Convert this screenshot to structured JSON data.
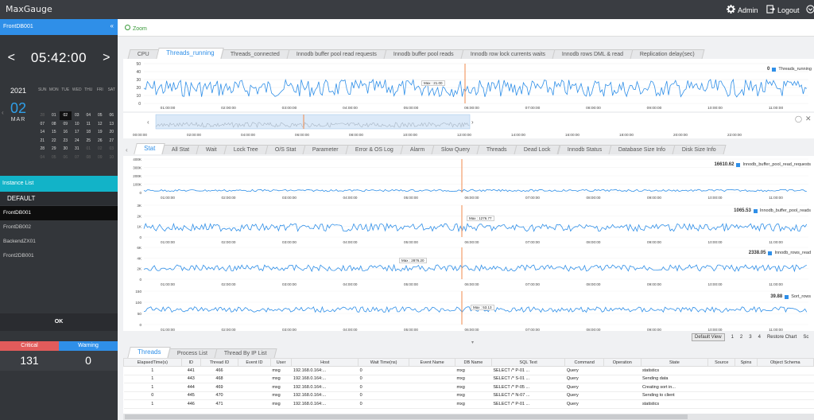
{
  "app": {
    "logo": "MaxGauge",
    "admin_label": "Admin",
    "logout_label": "Logout"
  },
  "sidebar": {
    "server_name": "FrontDB001",
    "collapse_glyph": "«",
    "time": "05:42:00",
    "prev_glyph": "<",
    "next_glyph": ">",
    "calendar": {
      "year": "2021",
      "day": "02",
      "month": "MAR",
      "day_headers": [
        "SUN",
        "MON",
        "TUE",
        "WED",
        "THU",
        "FRI",
        "SAT"
      ],
      "days": [
        {
          "d": "28",
          "dim": true
        },
        {
          "d": "01"
        },
        {
          "d": "02",
          "sel": true
        },
        {
          "d": "03"
        },
        {
          "d": "04"
        },
        {
          "d": "05"
        },
        {
          "d": "06"
        },
        {
          "d": "07"
        },
        {
          "d": "08"
        },
        {
          "d": "09"
        },
        {
          "d": "10"
        },
        {
          "d": "11"
        },
        {
          "d": "12"
        },
        {
          "d": "13"
        },
        {
          "d": "14"
        },
        {
          "d": "15"
        },
        {
          "d": "16"
        },
        {
          "d": "17"
        },
        {
          "d": "18"
        },
        {
          "d": "19"
        },
        {
          "d": "20"
        },
        {
          "d": "21"
        },
        {
          "d": "22"
        },
        {
          "d": "23"
        },
        {
          "d": "24"
        },
        {
          "d": "25"
        },
        {
          "d": "26"
        },
        {
          "d": "27"
        },
        {
          "d": "28"
        },
        {
          "d": "29"
        },
        {
          "d": "30"
        },
        {
          "d": "31"
        },
        {
          "d": "01",
          "dim": true
        },
        {
          "d": "02",
          "dim": true
        },
        {
          "d": "03",
          "dim": true
        },
        {
          "d": "04",
          "dim": true
        },
        {
          "d": "05",
          "dim": true
        },
        {
          "d": "06",
          "dim": true
        },
        {
          "d": "07",
          "dim": true
        },
        {
          "d": "08",
          "dim": true
        },
        {
          "d": "09",
          "dim": true
        },
        {
          "d": "10",
          "dim": true
        }
      ]
    },
    "instance_list_title": "Instance List",
    "group": "DEFAULT",
    "instances": [
      "FrontDB001",
      "FrontDB002",
      "BackendZX01",
      "Front2DB001"
    ],
    "ok_label": "OK",
    "critical_label": "Critical",
    "warning_label": "Warning",
    "critical_count": "131",
    "warning_count": "0"
  },
  "zoom_label": "Zoom",
  "top_tabs": [
    "CPU",
    "Threads_running",
    "Threads_connected",
    "Innodb buffer pool read requests",
    "Innodb buffer pool reads",
    "Innodb row lock currents waits",
    "Innodb rows DML & read",
    "Replication delay(sec)"
  ],
  "top_chart": {
    "yticks": [
      "50",
      "40",
      "30",
      "20",
      "10",
      "0"
    ],
    "xticks": [
      "01:00:00",
      "02:00:00",
      "03:00:00",
      "04:00:00",
      "05:00:00",
      "06:00:00",
      "07:00:00",
      "08:00:00",
      "09:00:00",
      "10:00:00",
      "11:00:00"
    ],
    "legend_value": "0",
    "legend_name": "Threads_running",
    "max_label": "Max : 21.00"
  },
  "navigator": {
    "xticks": [
      "00:00:00",
      "02:00:00",
      "04:00:00",
      "06:00:00",
      "08:00:00",
      "10:00:00",
      "12:00:00",
      "14:00:00",
      "16:00:00",
      "18:00:00",
      "20:00:00",
      "22:00:00"
    ]
  },
  "stat_tabs": [
    "Stat",
    "All Stat",
    "Wait",
    "Lock Tree",
    "O/S Stat",
    "Parameter",
    "Error & OS Log",
    "Alarm",
    "Slow Query",
    "Threads",
    "Dead Lock",
    "Innodb Status",
    "Database Size Info",
    "Disk Size Info"
  ],
  "stat_charts": [
    {
      "yticks": [
        "400K",
        "300K",
        "200K",
        "100K",
        "0"
      ],
      "legend_value": "16610.62",
      "legend_name": "Innodb_buffer_pool_read_requests",
      "max_label": ""
    },
    {
      "yticks": [
        "3K",
        "2K",
        "1K",
        "0"
      ],
      "legend_value": "1065.53",
      "legend_name": "Innodb_buffer_pool_reads",
      "max_label": "Max : 1276.77"
    },
    {
      "yticks": [
        "6K",
        "4K",
        "2K",
        "0"
      ],
      "legend_value": "2338.05",
      "legend_name": "Innodb_rows_read",
      "max_label": "Max : 2876.20"
    },
    {
      "yticks": [
        "150",
        "100",
        "50",
        "0"
      ],
      "legend_value": "39.88",
      "legend_name": "Sort_rows",
      "max_label": "Max : 53.13"
    }
  ],
  "stat_xticks": [
    "01:00:00",
    "02:00:00",
    "03:00:00",
    "04:00:00",
    "05:00:00",
    "06:00:00",
    "07:00:00",
    "08:00:00",
    "09:00:00",
    "10:00:00",
    "11:00:00"
  ],
  "view_buttons": {
    "default_view": "Default View",
    "pages": [
      "1",
      "2",
      "3",
      "4"
    ],
    "restore": "Restore Chart",
    "extra": "Sc"
  },
  "bottom_tabs": [
    "Threads",
    "Process List",
    "Thread By IP List"
  ],
  "table": {
    "columns": [
      "ElapsedTime(s)",
      "ID",
      "Thread ID",
      "Event ID",
      "User",
      "Host",
      "Wait Time(ns)",
      "Event Name",
      "DB Name",
      "SQL Text",
      "Command",
      "Operation",
      "State",
      "Source",
      "Spins",
      "Object Schema"
    ],
    "rows": [
      [
        "1",
        "441",
        "466",
        "",
        "mxg",
        "192.168.0.164:...",
        "0",
        "",
        "mxg",
        "SELECT /* P-01 ...",
        "Query",
        "",
        "statistics",
        "",
        "",
        ""
      ],
      [
        "1",
        "443",
        "468",
        "",
        "mxg",
        "192.168.0.164:...",
        "0",
        "",
        "mxg",
        "SELECT /* S-01 ...",
        "Query",
        "",
        "Sending data",
        "",
        "",
        ""
      ],
      [
        "1",
        "444",
        "469",
        "",
        "mxg",
        "192.168.0.164:...",
        "0",
        "",
        "mxg",
        "SELECT /* P-05 ...",
        "Query",
        "",
        "Creating sort in...",
        "",
        "",
        ""
      ],
      [
        "0",
        "445",
        "470",
        "",
        "mxg",
        "192.168.0.164:...",
        "0",
        "",
        "mxg",
        "SELECT /* N-07 ...",
        "Query",
        "",
        "Sending to client",
        "",
        "",
        ""
      ],
      [
        "1",
        "446",
        "471",
        "",
        "mxg",
        "192.168.0.164:...",
        "0",
        "",
        "mxg",
        "SELECT /* P-01 ...",
        "Query",
        "",
        "statistics",
        "",
        "",
        ""
      ]
    ]
  },
  "colors": {
    "accent": "#2f8fe8",
    "critical": "#e25b5b",
    "instance_header": "#12b3c8",
    "series_line": "#2f8fe8",
    "marker": "#f08a4b"
  }
}
